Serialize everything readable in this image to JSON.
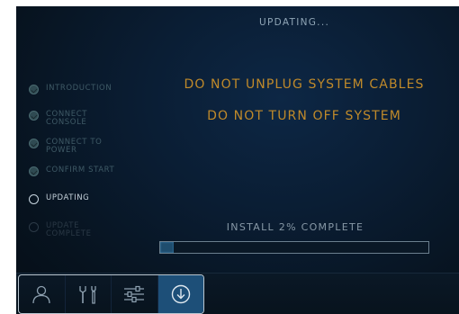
{
  "screen": {
    "title": "UPDATING..."
  },
  "steps": [
    {
      "label": "INTRODUCTION",
      "status": "done"
    },
    {
      "label": "CONNECT CONSOLE",
      "status": "done"
    },
    {
      "label": "CONNECT TO POWER",
      "status": "done"
    },
    {
      "label": "CONFIRM START",
      "status": "done"
    },
    {
      "label": "UPDATING",
      "status": "current"
    },
    {
      "label": "UPDATE COMPLETE",
      "status": "pending"
    }
  ],
  "warnings": {
    "line1": "DO NOT UNPLUG SYSTEM CABLES",
    "line2": "DO NOT TURN OFF SYSTEM"
  },
  "progress": {
    "label": "INSTALL 2% COMPLETE",
    "percent": 2
  },
  "bottom_tabs": [
    {
      "icon": "user-icon",
      "active": false
    },
    {
      "icon": "tools-icon",
      "active": false
    },
    {
      "icon": "sliders-icon",
      "active": false
    },
    {
      "icon": "download-icon",
      "active": true
    }
  ],
  "colors": {
    "warning": "#c08a2a",
    "active_tab": "#1d4f78",
    "progress_fill": "#1f4d6e"
  }
}
